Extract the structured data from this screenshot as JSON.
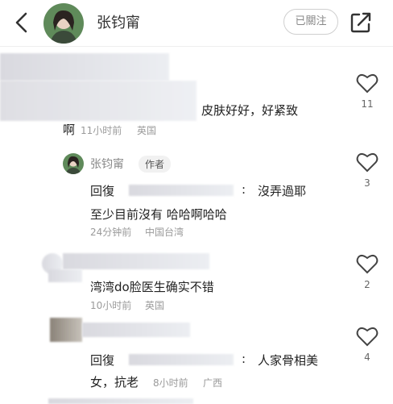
{
  "header": {
    "author_name": "张钧甯",
    "follow_label": "已關注"
  },
  "comments": [
    {
      "text_line1": "皮肤好好，好紧致",
      "text_line2": "啊",
      "time": "11小时前",
      "location": "英国",
      "likes": "11"
    },
    {
      "user": "张钧甯",
      "author_tag": "作者",
      "reply_prefix": "回復",
      "text_line1": "沒弄過耶",
      "text_line2": "至少目前沒有 哈哈啊哈哈",
      "time": "24分钟前",
      "location": "中国台湾",
      "likes": "3"
    },
    {
      "text_line1": "湾湾do脸医生确实不错",
      "time": "10小时前",
      "location": "英国",
      "likes": "2"
    },
    {
      "reply_prefix": "回復",
      "text_line1": "人家骨相美",
      "text_line2": "女，抗老",
      "time": "8小时前",
      "location": "广西",
      "likes": "4"
    }
  ]
}
